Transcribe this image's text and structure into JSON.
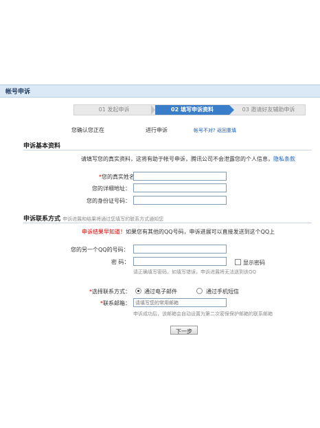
{
  "header": {
    "title": "帐号申诉"
  },
  "steps": [
    {
      "label": "01 发起申诉"
    },
    {
      "label": "02 填写申诉资料"
    },
    {
      "label": "03 邀请好友辅助申诉"
    }
  ],
  "confirm": {
    "label": "您确认您正在",
    "action": "进行申诉",
    "link": "帐号不对? 返回重填"
  },
  "basic": {
    "title": "申诉基本资料",
    "intro": "请填写您的真实资料，这将有助于帐号申诉，腾讯公司不会泄露您的个人信息，",
    "privacy_link": "隐私条款",
    "name_label": "您的真实姓名：",
    "address_label": "您的详细地址：",
    "id_label": "您的身份证号码："
  },
  "contact": {
    "title": "申诉联系方式",
    "title_note": "申诉进展和结果将通过您填写的联系方式通知您",
    "tip_red": "申诉结果早知道！",
    "tip_text": "如果您有其他的QQ号码，申诉进展可以直接发送到这个QQ上",
    "other_qq_label": "您的另一个QQ的号码：",
    "password_label": "密  码：",
    "show_password": "显示密码",
    "password_hint": "请正确填写密码，如填写错误，申诉进展将无法送到该QQ",
    "method_label": "选择联系方式：",
    "method_email": "通过电子邮件",
    "method_sms": "通过手机短信",
    "email_label": "联系邮箱：",
    "email_placeholder": "请填写您的常用邮箱",
    "email_hint": "申诉成功后，该邮箱会自动设置为第二次密保保护邮箱的联系邮箱"
  },
  "next_button": "下一步"
}
